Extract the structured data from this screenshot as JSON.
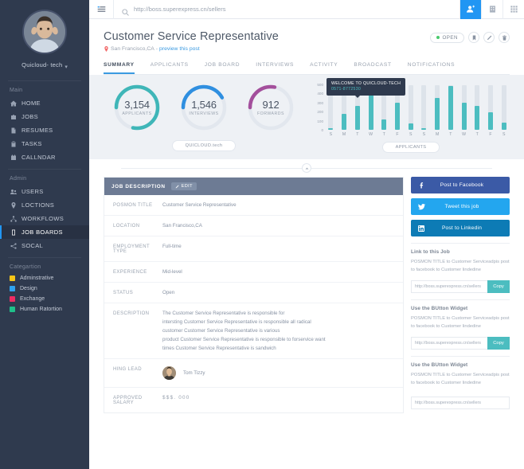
{
  "sidebar": {
    "profile": {
      "name": "Quicloud- tech",
      "chevron": "chevron-down-icon"
    },
    "groups": [
      {
        "title": "Main",
        "items": [
          {
            "label": "HOME",
            "icon": "home-icon",
            "active": false
          },
          {
            "label": "JOBS",
            "icon": "briefcase-icon",
            "active": false
          },
          {
            "label": "RESUMES",
            "icon": "document-icon",
            "active": false
          },
          {
            "label": "TASKS",
            "icon": "clipboard-icon",
            "active": false
          },
          {
            "label": "CALLNDAR",
            "icon": "calendar-icon",
            "active": false
          }
        ]
      },
      {
        "title": "Admin",
        "items": [
          {
            "label": "USERS",
            "icon": "users-icon",
            "active": false
          },
          {
            "label": "LOCTIONS",
            "icon": "pin-icon",
            "active": false
          },
          {
            "label": "WORKFLOWS",
            "icon": "workflow-icon",
            "active": false
          },
          {
            "label": "JOB BOARDS",
            "icon": "board-icon",
            "active": true
          },
          {
            "label": "SOCAL",
            "icon": "share-icon",
            "active": false
          }
        ]
      }
    ],
    "categories": {
      "title": "Categartion",
      "items": [
        {
          "label": "Adminstrative",
          "color": "#f5c518"
        },
        {
          "label": "Design",
          "color": "#2fa3ef"
        },
        {
          "label": "Exchange",
          "color": "#ef2c63"
        },
        {
          "label": "Human Ratortion",
          "color": "#1fc08a"
        }
      ]
    }
  },
  "topbar": {
    "menu_icon": "hamburger-icon",
    "search": {
      "icon": "search-icon",
      "value": "http://boss.superexpress.cn/sellers",
      "placeholder": "Search"
    },
    "actions": [
      {
        "name": "user-button",
        "icon": "user-add-icon",
        "accent": "#2196f3"
      },
      {
        "name": "apps-button",
        "icon": "building-icon"
      },
      {
        "name": "grid-button",
        "icon": "grid-icon"
      }
    ]
  },
  "header": {
    "title": "Customer Service Representative",
    "location": "San Francisco,CA",
    "separator": "-",
    "preview_link": "preview this post",
    "status_badge": "OPEN",
    "status_color": "#49c96d",
    "actions": [
      {
        "name": "bookmark-button",
        "icon": "bookmark-icon"
      },
      {
        "name": "edit-button",
        "icon": "pencil-icon"
      },
      {
        "name": "delete-button",
        "icon": "trash-icon"
      }
    ],
    "tabs": [
      {
        "label": "SUMMARY",
        "active": true
      },
      {
        "label": "APPLICANTS",
        "active": false
      },
      {
        "label": "JOB BOARD",
        "active": false
      },
      {
        "label": "INTERVIEWS",
        "active": false
      },
      {
        "label": "ACTIVITY",
        "active": false
      },
      {
        "label": "BROADCAST",
        "active": false
      },
      {
        "label": "NOTIFICATIONS",
        "active": false
      }
    ]
  },
  "stats": {
    "pill_label": "QUICLOUD.tech",
    "donuts": [
      {
        "value": "3,154",
        "caption": "APPLICANTS",
        "color": "#3fb6b8",
        "percent": 78
      },
      {
        "value": "1,546",
        "caption": "INTERVIEWS",
        "color": "#2f8fe0",
        "percent": 42
      },
      {
        "value": "912",
        "caption": "FORWARDS",
        "color": "#a34f9c",
        "percent": 28
      }
    ]
  },
  "chart_data": {
    "type": "bar",
    "title": "",
    "pill_label": "APPLICANTS",
    "xlabel": "",
    "ylabel": "",
    "ylim": [
      0,
      500
    ],
    "yticks": [
      500,
      400,
      300,
      200,
      100,
      0
    ],
    "grid": false,
    "legend": "none",
    "bar_color": "#4cbdc0",
    "track_color": "#dde3ea",
    "categories": [
      "S",
      "M",
      "T",
      "W",
      "T",
      "F",
      "S",
      "S",
      "M",
      "T",
      "W",
      "T",
      "F",
      "S"
    ],
    "values": [
      20,
      180,
      265,
      390,
      115,
      305,
      75,
      20,
      355,
      490,
      305,
      265,
      195,
      80
    ],
    "tooltip": {
      "title": "WELCOME TO QUICLOUD-TECH",
      "subtitle": "0571-8772530",
      "attached_to_index": 3
    }
  },
  "collapse": {
    "icon": "chevron-up-icon"
  },
  "job_description": {
    "panel_title": "JOB DESCRIPTION",
    "edit_label": "EDIT",
    "edit_icon": "pencil-icon",
    "rows": [
      {
        "label": "POSMON TITLE",
        "value": "Customer Service Representative"
      },
      {
        "label": "LOCATION",
        "value": "San Francisco,CA"
      },
      {
        "label": "EMPLOYMENT TYPE",
        "value": "Full-time"
      },
      {
        "label": "EXPERIENCE",
        "value": "Mid-level"
      },
      {
        "label": "STATUS",
        "value": "Open"
      }
    ],
    "description": {
      "label": "DESCRIPTION",
      "lines": [
        "The Customer Service Representative is responsible for",
        "intersting Customer Service Representative is responsible all radical",
        "customer Customer Service Representative is various",
        "product Customer Service Representative is responsible to forservice want",
        "times Customer Service Representative is sandwich"
      ]
    },
    "hiring_lead": {
      "label": "HING LEAD",
      "name": "Tom Tizzy",
      "avatar": "avatar-icon"
    },
    "approved_salary": {
      "label": "APPROVED SALARY",
      "value": "$$$. 000"
    }
  },
  "rail": {
    "social": [
      {
        "label": "Post to Facebook",
        "icon": "facebook-icon",
        "color": "#3b5aa6",
        "class": "fb"
      },
      {
        "label": "Tweet this job",
        "icon": "twitter-icon",
        "color": "#23a6ef",
        "class": "tw"
      },
      {
        "label": "Post to Linkedin",
        "icon": "linkedin-icon",
        "color": "#0d7bb5",
        "class": "li"
      }
    ],
    "sections": [
      {
        "title": "Link to this Job",
        "desc": "POSMON TITLE to Customer Serviceadpis post to facebook to Customer lindedine",
        "input_value": "http://boss.superexpress.cn/sellers",
        "button": "Copy",
        "has_button": true
      },
      {
        "title": "Use the BUtton Widget",
        "desc": "POSMON TITLE to Customer Serviceadpis post to facebook to Customer lindedine",
        "input_value": "http://boss.superexpress.cn/sellers",
        "button": "Copy",
        "has_button": true
      },
      {
        "title": "Use the BUtton Widget",
        "desc": "POSMON TITLE to Customer Serviceadpis post to facebook to Customer lindedine",
        "input_value": "http://boss.superexpress.cn/sellers",
        "button": "",
        "has_button": false
      }
    ]
  }
}
